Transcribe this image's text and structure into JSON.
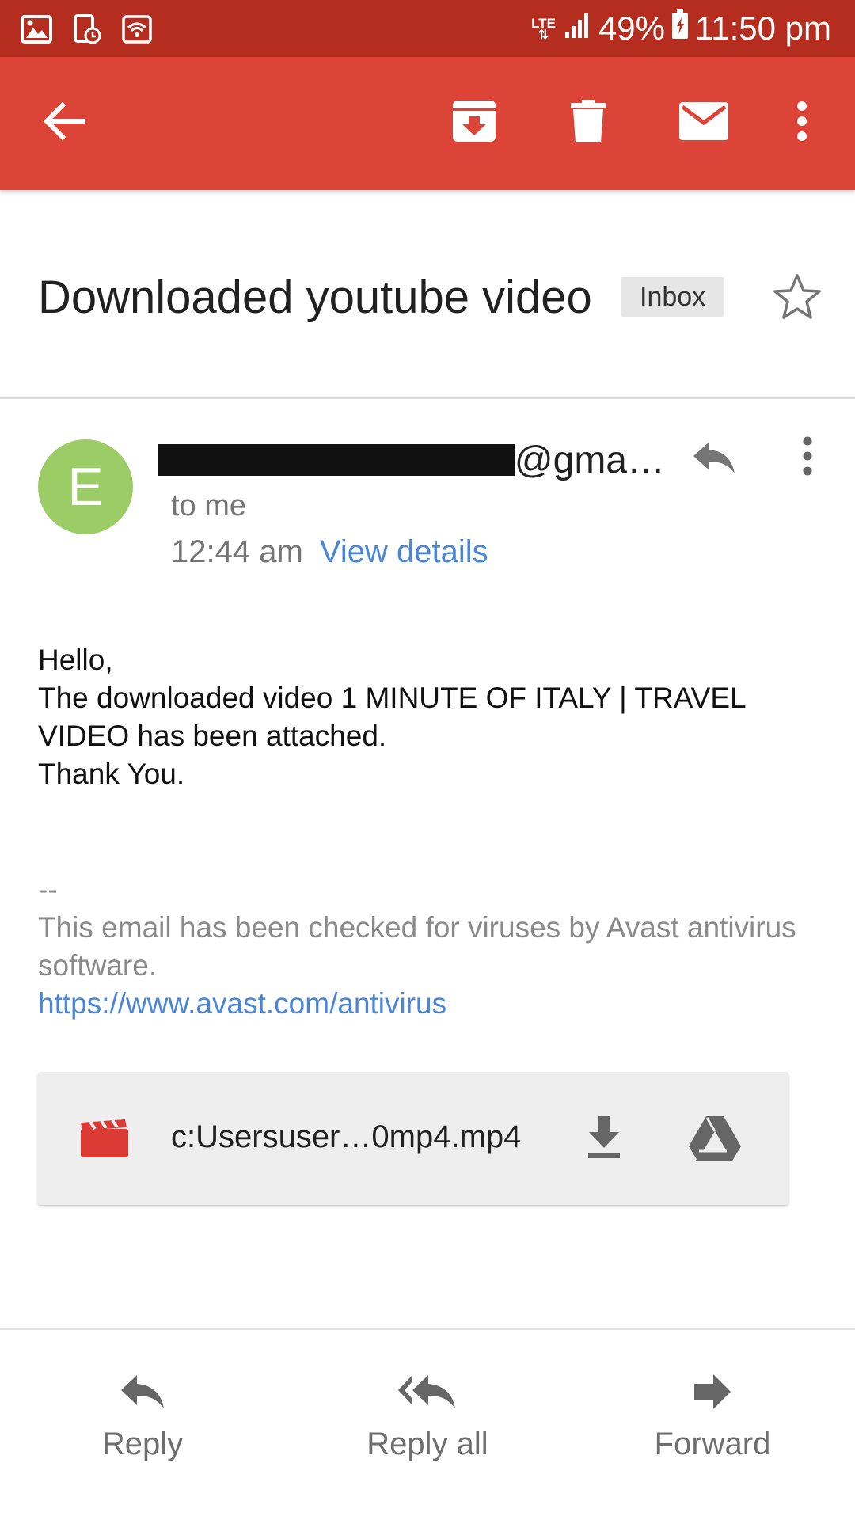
{
  "status_bar": {
    "network": "LTE",
    "battery": "49%",
    "time": "11:50 pm",
    "left_icons": [
      "image-icon",
      "screenshot-icon",
      "wifi-icon"
    ]
  },
  "toolbar": {
    "icons": [
      "back-arrow-icon",
      "archive-icon",
      "delete-icon",
      "mark-unread-icon",
      "more-vert-icon"
    ]
  },
  "email": {
    "subject": "Downloaded youtube video",
    "label": "Inbox",
    "sender_initial": "E",
    "sender_visible": "@gma…",
    "to": "to me",
    "time": "12:44 am",
    "details_link": "View details",
    "body": {
      "greeting": "Hello,",
      "line1": "The downloaded video 1 MINUTE OF ITALY | TRAVEL VIDEO has been attached.",
      "closing": "Thank You."
    },
    "signature": {
      "separator": "--",
      "text": "This email has been checked for viruses by Avast antivirus software.",
      "link": "https://www.avast.com/antivirus"
    },
    "attachment": {
      "name": "c:Usersuser…0mp4.mp4"
    }
  },
  "actions": {
    "reply": "Reply",
    "reply_all": "Reply all",
    "forward": "Forward"
  },
  "colors": {
    "status_bar": "#b52d1f",
    "toolbar": "#db4437",
    "avatar": "#9ccc65",
    "link": "#4a86d8",
    "attachment_icon": "#db3b34"
  }
}
